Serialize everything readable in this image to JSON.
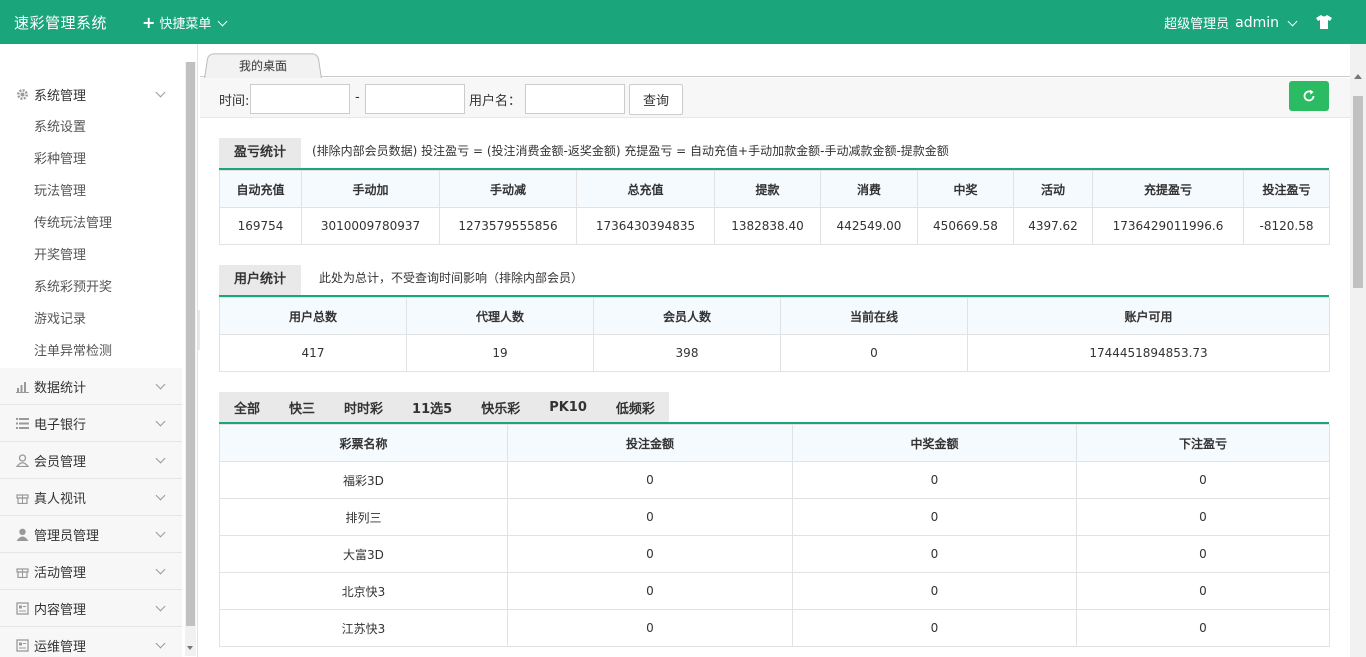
{
  "header": {
    "brand": "速彩管理系统",
    "quick_menu": "快捷菜单",
    "role": "超级管理员",
    "username": "admin"
  },
  "sidebar": {
    "groups": [
      {
        "label": "系统管理",
        "icon": "gear-icon",
        "items": [
          "系统设置",
          "彩种管理",
          "玩法管理",
          "传统玩法管理",
          "开奖管理",
          "系统彩预开奖",
          "游戏记录",
          "注单异常检测"
        ]
      },
      {
        "label": "数据统计",
        "icon": "chart-icon"
      },
      {
        "label": "电子银行",
        "icon": "list-icon"
      },
      {
        "label": "会员管理",
        "icon": "user-outline-icon"
      },
      {
        "label": "真人视讯",
        "icon": "gift-icon"
      },
      {
        "label": "管理员管理",
        "icon": "user-icon"
      },
      {
        "label": "活动管理",
        "icon": "gift-icon"
      },
      {
        "label": "内容管理",
        "icon": "document-icon"
      },
      {
        "label": "运维管理",
        "icon": "document-icon"
      }
    ]
  },
  "tabs": {
    "desktop": "我的桌面"
  },
  "filter": {
    "time_label": "时间:",
    "dash": "-",
    "username_label": "用户名：",
    "start_value": "",
    "end_value": "",
    "username_value": "",
    "query_button": "查询"
  },
  "profit": {
    "title": "盈亏统计",
    "note": "(排除内部会员数据)  投注盈亏 = (投注消费金额-返奖金额)    充提盈亏 = 自动充值+手动加款金额-手动减款金额-提款金额",
    "headers": [
      "自动充值",
      "手动加",
      "手动减",
      "总充值",
      "提款",
      "消费",
      "中奖",
      "活动",
      "充提盈亏",
      "投注盈亏"
    ],
    "values": [
      "169754",
      "3010009780937",
      "1273579555856",
      "1736430394835",
      "1382838.40",
      "442549.00",
      "450669.58",
      "4397.62",
      "1736429011996.6",
      "-8120.58"
    ]
  },
  "users": {
    "title": "用户统计",
    "note": "此处为总计，不受查询时间影响（排除内部会员）",
    "headers": [
      "用户总数",
      "代理人数",
      "会员人数",
      "当前在线",
      "账户可用"
    ],
    "values": [
      "417",
      "19",
      "398",
      "0",
      "1744451894853.73"
    ]
  },
  "lottery": {
    "tabs": [
      "全部",
      "快三",
      "时时彩",
      "11选5",
      "快乐彩",
      "PK10",
      "低频彩"
    ],
    "headers": [
      "彩票名称",
      "投注金额",
      "中奖金额",
      "下注盈亏"
    ],
    "rows": [
      [
        "福彩3D",
        "0",
        "0",
        "0"
      ],
      [
        "排列三",
        "0",
        "0",
        "0"
      ],
      [
        "大富3D",
        "0",
        "0",
        "0"
      ],
      [
        "北京快3",
        "0",
        "0",
        "0"
      ],
      [
        "江苏快3",
        "0",
        "0",
        "0"
      ]
    ]
  },
  "colors": {
    "header_bg": "#1aa57a",
    "accent": "#1aa57a",
    "refresh_btn": "#2bbb63"
  }
}
